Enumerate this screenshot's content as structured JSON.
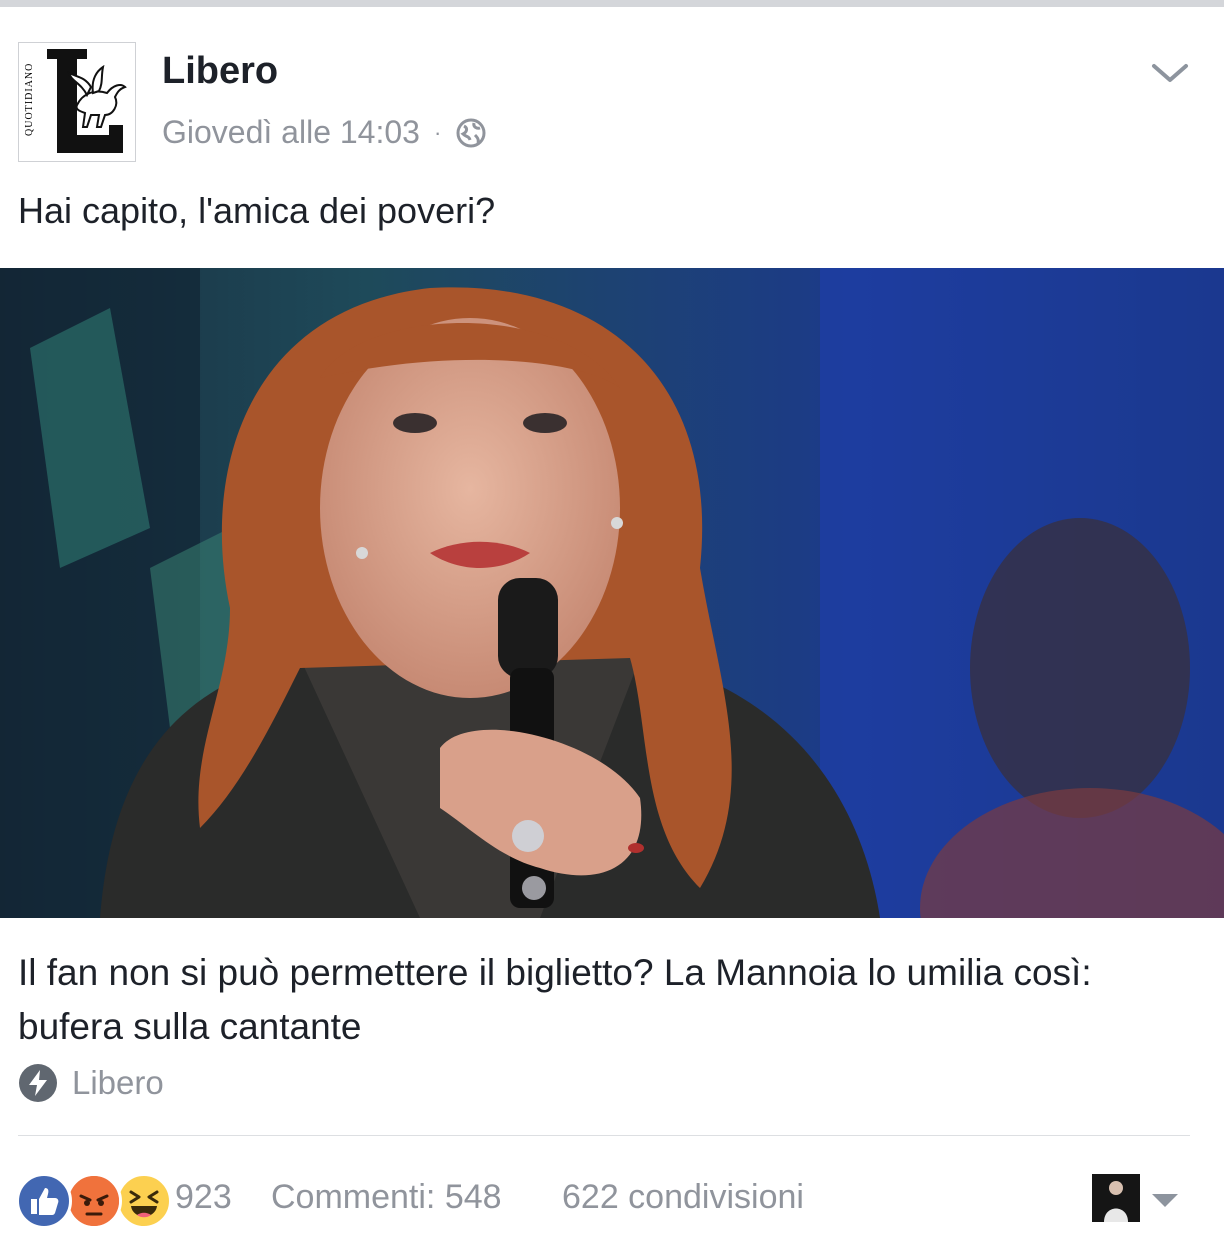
{
  "post": {
    "page_name": "Libero",
    "timestamp": "Giovedì alle 14:03",
    "separator": "·",
    "privacy_icon": "globe-icon",
    "text": "Hai capito, l'amica dei poveri?",
    "logo_text": "QUOTIDIANO"
  },
  "link": {
    "headline": "Il fan non si può permettere il biglietto? La Mannoia lo umilia così: bufera sulla cantante",
    "source": "Libero",
    "source_icon": "lightning-bolt-icon"
  },
  "footer": {
    "reaction_count": "923",
    "comments": "Commenti: 548",
    "shares": "622 condivisioni",
    "reactions": [
      "like",
      "angry",
      "haha"
    ]
  },
  "colors": {
    "text_primary": "#1d2129",
    "text_secondary": "#90949c",
    "like_blue": "#4267b2",
    "angry_orange": "#f26f4b",
    "haha_yellow": "#fcd050"
  }
}
